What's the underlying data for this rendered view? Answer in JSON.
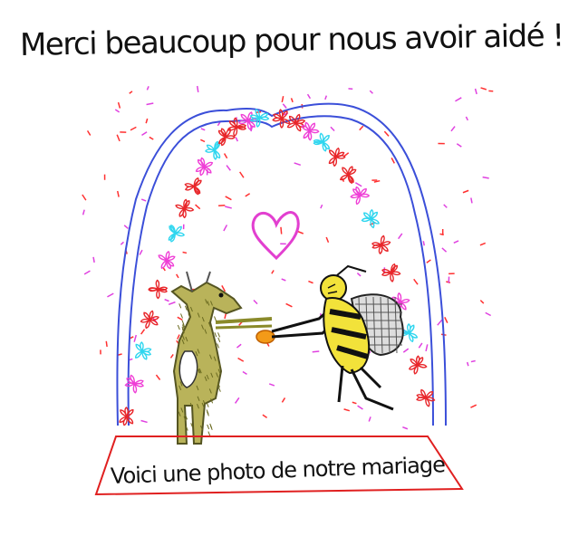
{
  "drawing": {
    "title_text": "Merci beaucoup pour nous avoir aidé !",
    "caption_text": "Voici une photo de notre mariage",
    "subjects": [
      "goat-figure",
      "bee-figure",
      "heart",
      "flower-arch",
      "red-carpet"
    ]
  },
  "colors": {
    "ink": "#111111",
    "arch_blue": "#3b4fd9",
    "flower_red": "#e8262a",
    "flower_pink": "#ef3fd6",
    "flower_cyan": "#2fd6ef",
    "heart_magenta": "#e23fd0",
    "goat_olive": "#8a8a2a",
    "bee_yellow": "#f2e23a",
    "ring_orange": "#f39a18",
    "carpet_red": "#e02020",
    "confetti_red": "#ff3030",
    "confetti_magenta": "#e040e0"
  }
}
